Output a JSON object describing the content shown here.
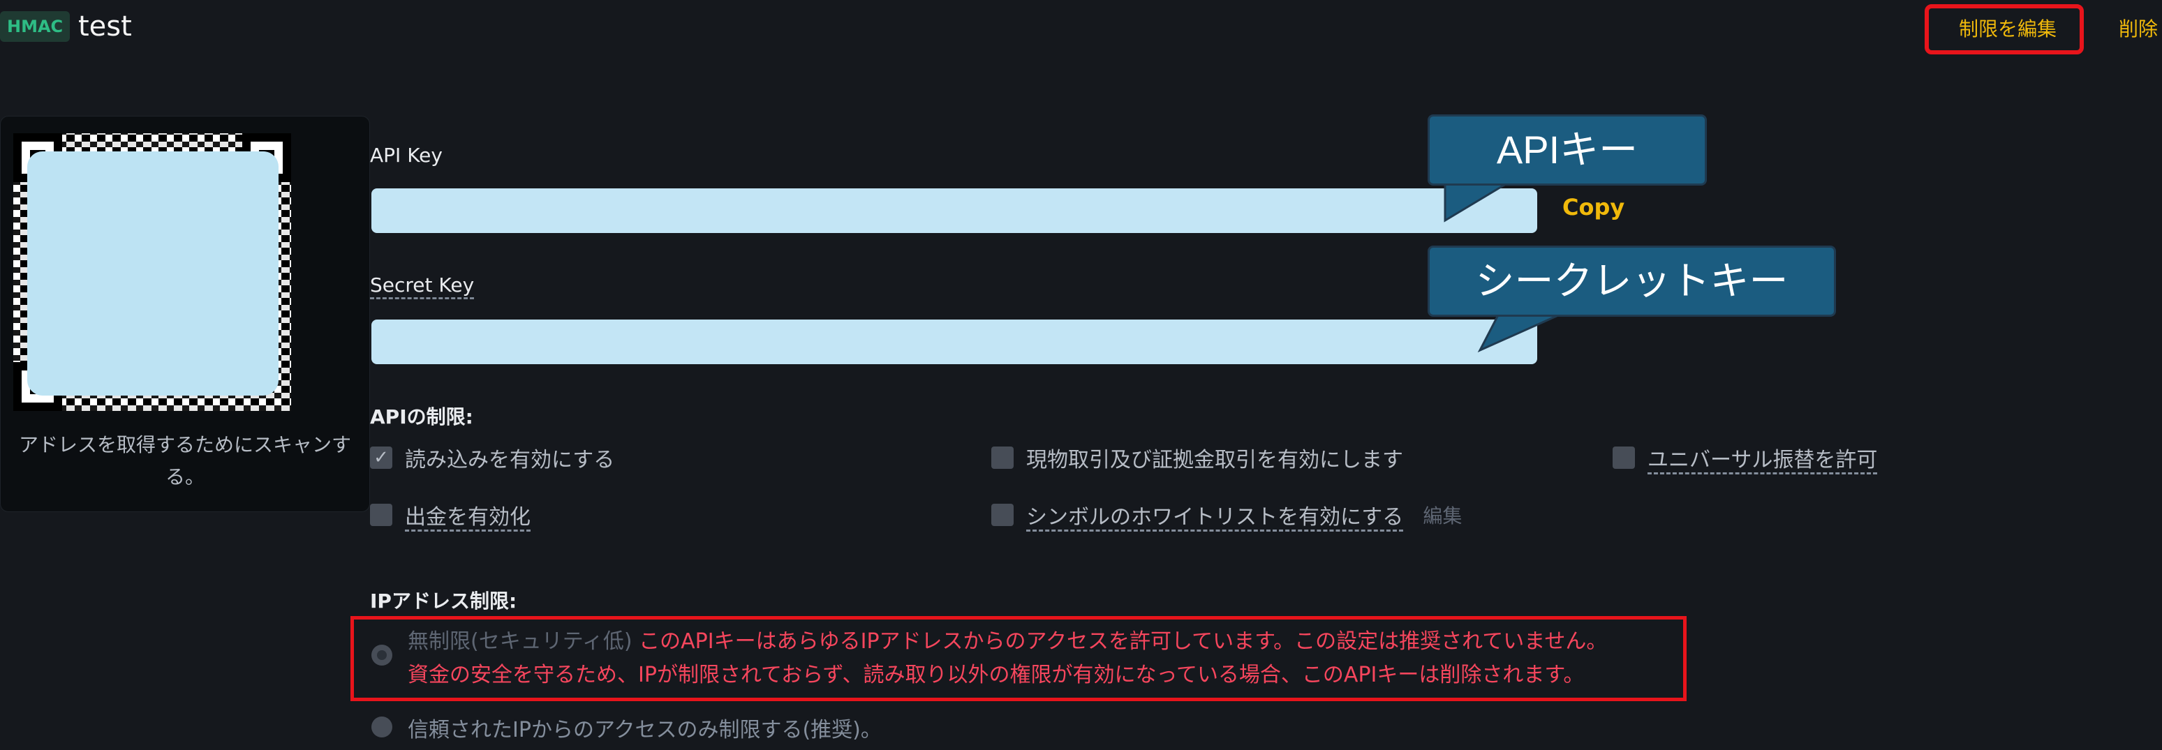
{
  "header": {
    "badge": "HMAC",
    "key_name": "test",
    "edit_restrictions": "制限を編集",
    "delete": "削除"
  },
  "qr": {
    "caption": "アドレスを取得するためにスキャンする。"
  },
  "fields": {
    "api_key_label": "API Key",
    "secret_key_label": "Secret Key",
    "copy": "Copy"
  },
  "callouts": {
    "api_key": "APIキー",
    "secret_key": "シークレットキー"
  },
  "api_restrictions": {
    "title": "APIの制限:",
    "options": [
      {
        "label": "読み込みを有効にする",
        "checked": true
      },
      {
        "label": "現物取引及び証拠金取引を有効にします",
        "checked": false
      },
      {
        "label": "ユニバーサル振替を許可",
        "checked": false
      },
      {
        "label": "出金を有効化",
        "checked": false
      },
      {
        "label": "シンボルのホワイトリストを有効にする",
        "checked": false
      }
    ],
    "whitelist_edit": "編集"
  },
  "ip_restrictions": {
    "title": "IPアドレス制限:",
    "unrestricted_label": "無制限(セキュリティ低)",
    "warning_line1": "このAPIキーはあらゆるIPアドレスからのアクセスを許可しています。この設定は推奨されていません。",
    "warning_line2": "資金の安全を守るため、IPが制限されておらず、読み取り以外の権限が有効になっている場合、このAPIキーは削除されます。",
    "trusted_label": "信頼されたIPからのアクセスのみ制限する(推奨)。"
  },
  "colors": {
    "background": "#15181d",
    "accent": "#f0b90b",
    "warning": "#f6465d",
    "highlight_border": "#e8141b",
    "callout": "#1b5c80",
    "key_box": "#c3e5f5"
  }
}
